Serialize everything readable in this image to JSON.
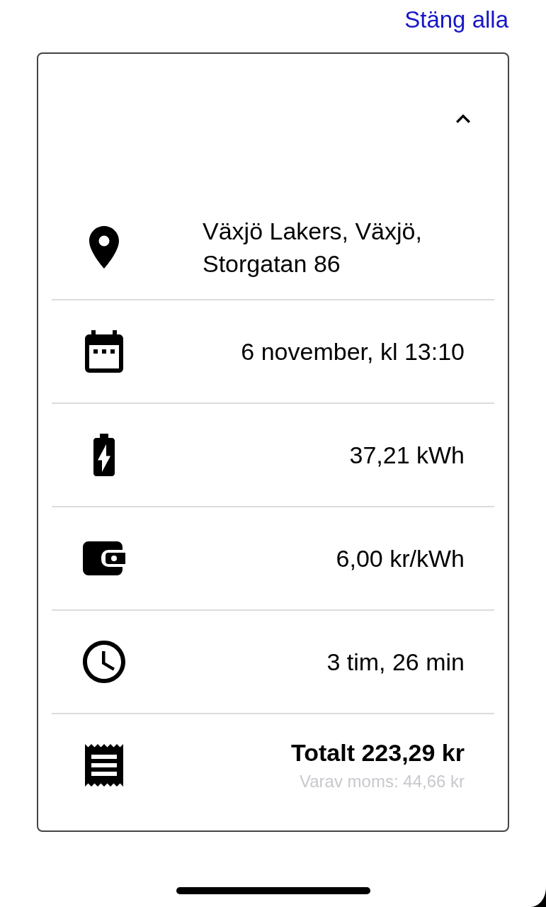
{
  "close_all_link": "Stäng alla",
  "card": {
    "expanded": true,
    "rows": [
      {
        "kind": "location",
        "value": "Växjö Lakers, Växjö, Storgatan 86"
      },
      {
        "kind": "date",
        "value": "6 november, kl 13:10"
      },
      {
        "kind": "energy",
        "value": "37,21 kWh"
      },
      {
        "kind": "price",
        "value": "6,00 kr/kWh"
      },
      {
        "kind": "duration",
        "value": "3 tim, 26 min"
      },
      {
        "kind": "total",
        "value": "Totalt 223,29 kr",
        "note": "Varav moms: 44,66 kr"
      }
    ]
  }
}
